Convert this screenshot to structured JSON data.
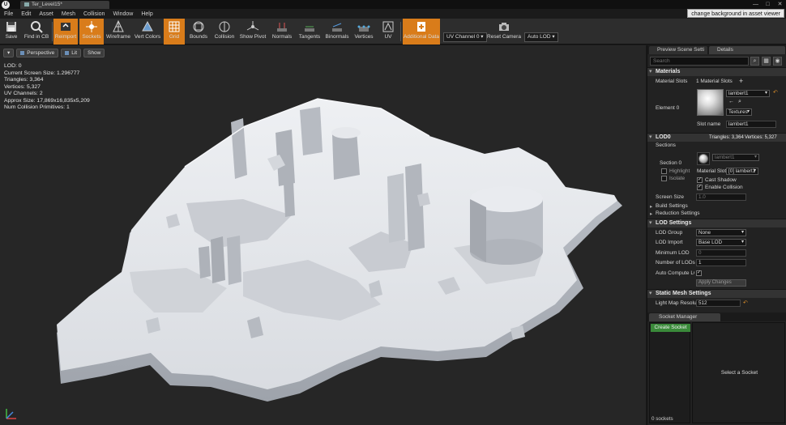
{
  "window": {
    "tab_label": "Ter_Level15*",
    "logo_letter": "U",
    "controls": [
      "—",
      "□",
      "✕"
    ],
    "tooltip": "change background in asset viewer"
  },
  "menu": [
    "File",
    "Edit",
    "Asset",
    "Mesh",
    "Collision",
    "Window",
    "Help"
  ],
  "toolbar": {
    "buttons": [
      {
        "label": "Save",
        "icon": "save-icon",
        "active": false
      },
      {
        "label": "Find in CB",
        "icon": "find-in-cb-icon",
        "active": false
      },
      {
        "label": "Reimport",
        "icon": "reimport-icon",
        "active": true
      },
      {
        "label": "Sockets",
        "icon": "sockets-icon",
        "active": true
      },
      {
        "label": "Wireframe",
        "icon": "wireframe-icon",
        "active": false
      },
      {
        "label": "Vert Colors",
        "icon": "vert-colors-icon",
        "active": false
      },
      {
        "label": "Grid",
        "icon": "grid-icon",
        "active": true
      },
      {
        "label": "Bounds",
        "icon": "bounds-icon",
        "active": false
      },
      {
        "label": "Collision",
        "icon": "collision-icon",
        "active": false
      },
      {
        "label": "Show Pivot",
        "icon": "show-pivot-icon",
        "active": false
      },
      {
        "label": "Normals",
        "icon": "normals-icon",
        "active": false
      },
      {
        "label": "Tangents",
        "icon": "tangents-icon",
        "active": false
      },
      {
        "label": "Binormals",
        "icon": "binormals-icon",
        "active": false
      },
      {
        "label": "Vertices",
        "icon": "vertices-icon",
        "active": false
      },
      {
        "label": "UV",
        "icon": "uv-icon",
        "active": false
      },
      {
        "label": "Additional Data",
        "icon": "additional-data-icon",
        "active": true
      },
      {
        "label": "Reset Camera",
        "icon": "reset-camera-icon",
        "active": false
      }
    ],
    "uv_channel": "UV Channel 0",
    "auto_lod": "Auto LOD"
  },
  "viewport": {
    "perspective": "Perspective",
    "lit": "Lit",
    "show": "Show",
    "stats": [
      "LOD: 0",
      "Current Screen Size: 1.296777",
      "Triangles: 3,364",
      "Vertices: 5,327",
      "UV Channels: 2",
      "Approx Size: 17,869x16,835x5,209",
      "Num Collision Primitives: 1"
    ]
  },
  "panel": {
    "tabs": [
      "Preview Scene Setti",
      "Details"
    ],
    "search_placeholder": "Search",
    "materials": {
      "header": "Materials",
      "slots_label": "Material Slots",
      "slots_value": "1 Material Slots",
      "add": "+",
      "element_label": "Element 0",
      "material_name": "lambert1",
      "textures": "Textures",
      "slot_name_label": "Slot name",
      "slot_name_value": "lambert1"
    },
    "lod0": {
      "header": "LOD0",
      "triangles": "Triangles: 3,364",
      "vertices": "Vertices: 5,327",
      "sections": "Sections",
      "section0": "Section 0",
      "highlight": "Highlight",
      "isolate": "Isolate",
      "material_name": "lambert1",
      "material_slot_label": "Material Slot",
      "material_slot_value": "[0] lambert1",
      "cast_shadow": "Cast Shadow",
      "enable_collision": "Enable Collision",
      "screen_size_label": "Screen Size",
      "screen_size_value": "1.0",
      "build_settings": "Build Settings",
      "reduction_settings": "Reduction Settings"
    },
    "lod_settings": {
      "header": "LOD Settings",
      "lod_group_label": "LOD Group",
      "lod_group_value": "None",
      "lod_import_label": "LOD Import",
      "lod_import_value": "Base LOD",
      "min_lod_label": "Minimum LOD",
      "min_lod_value": "0",
      "num_lods_label": "Number of LODs",
      "num_lods_value": "1",
      "auto_compute_label": "Auto Compute LOD",
      "apply_changes": "Apply Changes"
    },
    "static_mesh": {
      "header": "Static Mesh Settings",
      "light_map_label": "Light Map Resolut",
      "light_map_value": "512"
    },
    "socket_manager": {
      "tab": "Socket Manager",
      "create": "Create Socket",
      "select": "Select a Socket",
      "count": "0 sockets"
    }
  },
  "colors": {
    "accent_orange": "#d97c1a",
    "create_green": "#3a8a3a",
    "viewport_bg": "#262626"
  }
}
